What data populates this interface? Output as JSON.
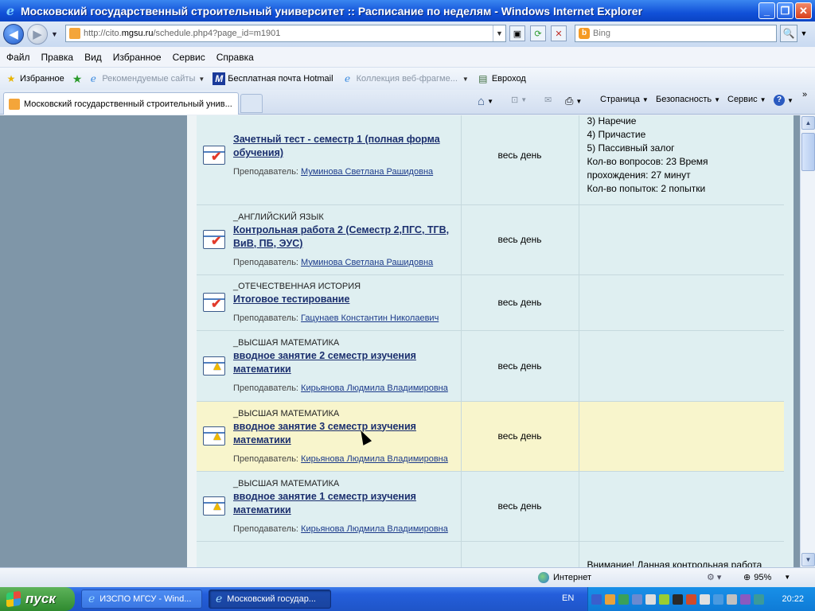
{
  "window": {
    "title": "Московский государственный строительный университет :: Расписание по неделям - Windows Internet Explorer",
    "minimize": "_",
    "maximize": "❐",
    "close": "✕"
  },
  "address": {
    "url_prefix": "http://cito.",
    "url_host": "mgsu.ru",
    "url_suffix": "/schedule.php4?page_id=m1901",
    "search_placeholder": "Bing",
    "back": "◀",
    "forward": "▶",
    "search_glyph": "🔍"
  },
  "menu": [
    "Файл",
    "Правка",
    "Вид",
    "Избранное",
    "Сервис",
    "Справка"
  ],
  "favorites_bar": {
    "favorites_label": "Избранное",
    "items": [
      {
        "label": "Рекомендуемые сайты",
        "icon": "ie-icon",
        "disabled": true,
        "dropdown": true
      },
      {
        "label": "Бесплатная почта Hotmail",
        "icon": "msn-icon",
        "disabled": false,
        "dropdown": false
      },
      {
        "label": "Коллекция веб-фрагме...",
        "icon": "ie-icon",
        "disabled": true,
        "dropdown": true
      },
      {
        "label": "Евроход",
        "icon": "page-icon",
        "disabled": false,
        "dropdown": false
      }
    ]
  },
  "tabs": {
    "active": "Московский государственный строительный унив...",
    "commands": [
      "Страница",
      "Безопасность",
      "Сервис"
    ]
  },
  "schedule": {
    "rows": [
      {
        "subject": "",
        "name": "Зачетный тест - семестр 1 (полная форма обучения)",
        "teacher_label": "Преподаватель:",
        "teacher": "Муминова Светлана Рашидовна",
        "time": "весь день",
        "icon": "test",
        "highlight": false,
        "notes": [
          "3) Наречие",
          "4) Причастие",
          "5) Пассивный залог",
          "Кол-во вопросов: 23 Время",
          "прохождения: 27 минут",
          "Кол-во попыток: 2 попытки"
        ]
      },
      {
        "subject": "_АНГЛИЙСКИЙ ЯЗЫК",
        "name": "Контрольная работа 2 (Семестр 2,ПГС, ТГВ, ВиВ, ПБ, ЭУС)",
        "teacher_label": "Преподаватель:",
        "teacher": "Муминова Светлана Рашидовна",
        "time": "весь день",
        "icon": "test",
        "highlight": false,
        "notes": []
      },
      {
        "subject": "_ОТЕЧЕСТВЕННАЯ ИСТОРИЯ",
        "name": "Итоговое тестирование",
        "teacher_label": "Преподаватель:",
        "teacher": "Гацунаев Константин Николаевич",
        "time": "весь день",
        "icon": "test",
        "highlight": false,
        "notes": []
      },
      {
        "subject": "_ВЫСШАЯ МАТЕМАТИКА",
        "name": "вводное занятие 2 семестр изучения математики",
        "teacher_label": "Преподаватель:",
        "teacher": "Кирьянова Людмила Владимировна",
        "time": "весь день",
        "icon": "bell",
        "highlight": false,
        "notes": []
      },
      {
        "subject": "_ВЫСШАЯ МАТЕМАТИКА",
        "name": "вводное занятие 3 семестр изучения математики",
        "teacher_label": "Преподаватель:",
        "teacher": "Кирьянова Людмила Владимировна",
        "time": "весь день",
        "icon": "bell",
        "highlight": true,
        "notes": []
      },
      {
        "subject": "_ВЫСШАЯ МАТЕМАТИКА",
        "name": "вводное занятие 1 семестр изучения математики",
        "teacher_label": "Преподаватель:",
        "teacher": "Кирьянова Людмила Владимировна",
        "time": "весь день",
        "icon": "bell",
        "highlight": false,
        "notes": []
      },
      {
        "subject": "",
        "name": "",
        "teacher_label": "",
        "teacher": "",
        "time": "",
        "icon": "",
        "highlight": false,
        "notes": [
          "Внимание! Данная контрольная работа"
        ]
      }
    ]
  },
  "status": {
    "zone": "Интернет",
    "zoom": "95%"
  },
  "taskbar": {
    "start": "пуск",
    "tasks": [
      "ИЗСПО МГСУ - Wind...",
      "Московский государ..."
    ],
    "lang": "EN",
    "clock": "20:22"
  },
  "colors": {
    "highlight_row": "#f8f5cc",
    "link": "#1b2f6e",
    "title_blue": "#1151d8"
  }
}
